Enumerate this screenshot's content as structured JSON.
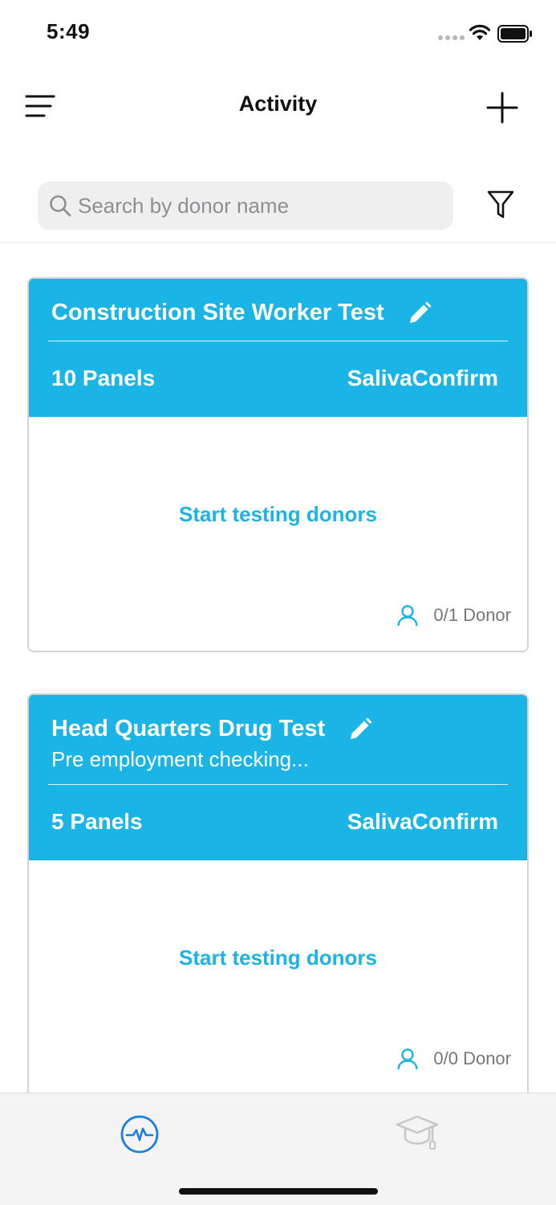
{
  "status_bar": {
    "time": "5:49",
    "icons": [
      "cellular-dots-icon",
      "wifi-icon",
      "battery-icon"
    ]
  },
  "nav": {
    "title": "Activity",
    "left_icon": "menu-icon",
    "right_icon": "plus-icon"
  },
  "search": {
    "value": "",
    "placeholder": "Search by donor name",
    "filter_icon": "filter-icon"
  },
  "cards": [
    {
      "title": "Construction Site Worker Test",
      "subtitle": "",
      "panels": "10 Panels",
      "product": "SalivaConfirm",
      "action": "Start testing donors",
      "donor_count": "0/1 Donor"
    },
    {
      "title": "Head Quarters Drug Test",
      "subtitle": "Pre employment checking...",
      "panels": "5 Panels",
      "product": "SalivaConfirm",
      "action": "Start testing donors",
      "donor_count": "0/0 Donor"
    }
  ],
  "tab_bar": {
    "tabs": [
      {
        "icon": "activity-icon",
        "active": true
      },
      {
        "icon": "graduation-cap-icon",
        "active": false
      }
    ]
  },
  "colors": {
    "accent": "#1ab4e6",
    "tab_active": "#1a7fe0",
    "tab_inactive": "#c8c8c8"
  }
}
